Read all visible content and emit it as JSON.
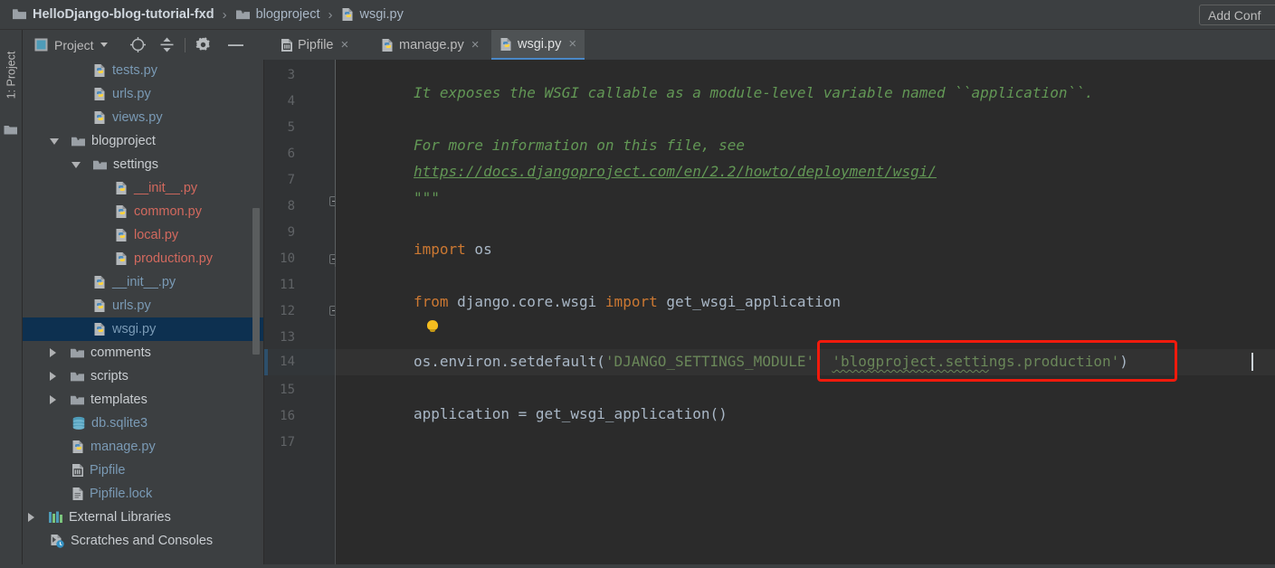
{
  "window": {
    "breadcrumb": [
      {
        "label": "HelloDjango-blog-tutorial-fxd",
        "icon": "folder-icon",
        "bold": true
      },
      {
        "label": "blogproject",
        "icon": "folder-icon",
        "bold": false
      },
      {
        "label": "wsgi.py",
        "icon": "python-file-icon",
        "bold": false
      }
    ],
    "separator": "›",
    "add_config_label": "Add Conf"
  },
  "toolstrip": {
    "project_tab_label": "1: Project",
    "folder_icon": "folder-icon"
  },
  "panel_toolbar": {
    "title": "Project",
    "dropdown_icon": "chevron-down-icon",
    "buttons": [
      {
        "name": "locate-icon",
        "label": ""
      },
      {
        "name": "collapse-all-icon",
        "label": ""
      },
      {
        "name": "gear-icon",
        "label": ""
      },
      {
        "name": "hide-icon",
        "label": ""
      }
    ]
  },
  "tabs": [
    {
      "label": "Pipfile",
      "icon": "pipfile-icon",
      "active": false,
      "close": "×"
    },
    {
      "label": "manage.py",
      "icon": "python-file-icon",
      "active": false,
      "close": "×"
    },
    {
      "label": "wsgi.py",
      "icon": "python-file-icon",
      "active": true,
      "close": "×"
    }
  ],
  "tree": {
    "items": [
      {
        "label": "",
        "icon": "python-file-icon",
        "indent": 4,
        "arrow": "none",
        "color": "blue",
        "clipped": true
      },
      {
        "label": "tests.py",
        "icon": "python-file-icon",
        "indent": 4,
        "arrow": "none",
        "color": "blue"
      },
      {
        "label": "urls.py",
        "icon": "python-file-icon",
        "indent": 4,
        "arrow": "none",
        "color": "blue"
      },
      {
        "label": "views.py",
        "icon": "python-file-icon",
        "indent": 4,
        "arrow": "none",
        "color": "blue"
      },
      {
        "label": "blogproject",
        "icon": "folder-icon",
        "indent": 2,
        "arrow": "open",
        "color": "white"
      },
      {
        "label": "settings",
        "icon": "folder-icon",
        "indent": 3,
        "arrow": "open",
        "color": "white"
      },
      {
        "label": "__init__.py",
        "icon": "python-file-icon",
        "indent": 5,
        "arrow": "none",
        "color": "red"
      },
      {
        "label": "common.py",
        "icon": "python-file-icon",
        "indent": 5,
        "arrow": "none",
        "color": "red"
      },
      {
        "label": "local.py",
        "icon": "python-file-icon",
        "indent": 5,
        "arrow": "none",
        "color": "red"
      },
      {
        "label": "production.py",
        "icon": "python-file-icon",
        "indent": 5,
        "arrow": "none",
        "color": "red"
      },
      {
        "label": "__init__.py",
        "icon": "python-file-icon",
        "indent": 4,
        "arrow": "none",
        "color": "blue"
      },
      {
        "label": "urls.py",
        "icon": "python-file-icon",
        "indent": 4,
        "arrow": "none",
        "color": "blue"
      },
      {
        "label": "wsgi.py",
        "icon": "python-file-icon",
        "indent": 4,
        "arrow": "none",
        "color": "blue",
        "selected": true
      },
      {
        "label": "comments",
        "icon": "folder-icon",
        "indent": 2,
        "arrow": "closed",
        "color": "white"
      },
      {
        "label": "scripts",
        "icon": "folder-icon",
        "indent": 2,
        "arrow": "closed",
        "color": "white"
      },
      {
        "label": "templates",
        "icon": "folder-icon",
        "indent": 2,
        "arrow": "closed",
        "color": "white"
      },
      {
        "label": "db.sqlite3",
        "icon": "database-icon",
        "indent": 3,
        "arrow": "none",
        "color": "blue"
      },
      {
        "label": "manage.py",
        "icon": "python-file-icon",
        "indent": 3,
        "arrow": "none",
        "color": "blue"
      },
      {
        "label": "Pipfile",
        "icon": "pipfile-icon",
        "indent": 3,
        "arrow": "none",
        "color": "blue"
      },
      {
        "label": "Pipfile.lock",
        "icon": "lockfile-icon",
        "indent": 3,
        "arrow": "none",
        "color": "blue"
      },
      {
        "label": "External Libraries",
        "icon": "libraries-icon",
        "indent": 1,
        "arrow": "closed",
        "color": "white"
      },
      {
        "label": "Scratches and Consoles",
        "icon": "scratches-icon",
        "indent": 2,
        "arrow": "none",
        "color": "white"
      }
    ]
  },
  "editor": {
    "file": "wsgi.py",
    "first_visible_line": 3,
    "gutter_lines": [
      "3",
      "4",
      "5",
      "6",
      "7",
      "8",
      "9",
      "10",
      "11",
      "12",
      "13",
      "14",
      "15",
      "16",
      "17"
    ],
    "current_line": "14",
    "lines": {
      "l4": "It exposes the WSGI callable as a module-level variable named ``application``.",
      "l6": "For more information on this file, see",
      "l7": "https://docs.djangoproject.com/en/2.2/howto/deployment/wsgi/",
      "l8": "\"\"\"",
      "l10_kw": "import",
      "l10_mod": " os",
      "l12_kw1": "from",
      "l12_mod": " django.core.wsgi ",
      "l12_kw2": "import",
      "l12_name": " get_wsgi_application",
      "l14_call": "os.environ.setdefault(",
      "l14_arg1": "'DJANGO_SETTINGS_MODULE'",
      "l14_comma": ", ",
      "l14_arg2_a": "'blogproject.setti",
      "l14_arg2_b": "ngs.production'",
      "l14_close": ")",
      "l16": "application = get_wsgi_application()"
    },
    "intention_icon": "lightbulb-icon",
    "annotation": {
      "name": "red-highlight-box",
      "color": "#f11a0c",
      "target_text": "'blogproject.settings.production')"
    }
  },
  "colors": {
    "background": "#3c3f41",
    "editor_background": "#2b2b2b",
    "gutter_background": "#313335",
    "selection": "#0d3050",
    "accent": "#4a88c7",
    "keyword": "#cc7832",
    "string": "#6a8759",
    "docstring": "#629755",
    "identifier": "#a9b7c6",
    "unversioned_file": "#d2695e",
    "annotation_red": "#f11a0c",
    "bulb_yellow": "#f5bd1f"
  }
}
